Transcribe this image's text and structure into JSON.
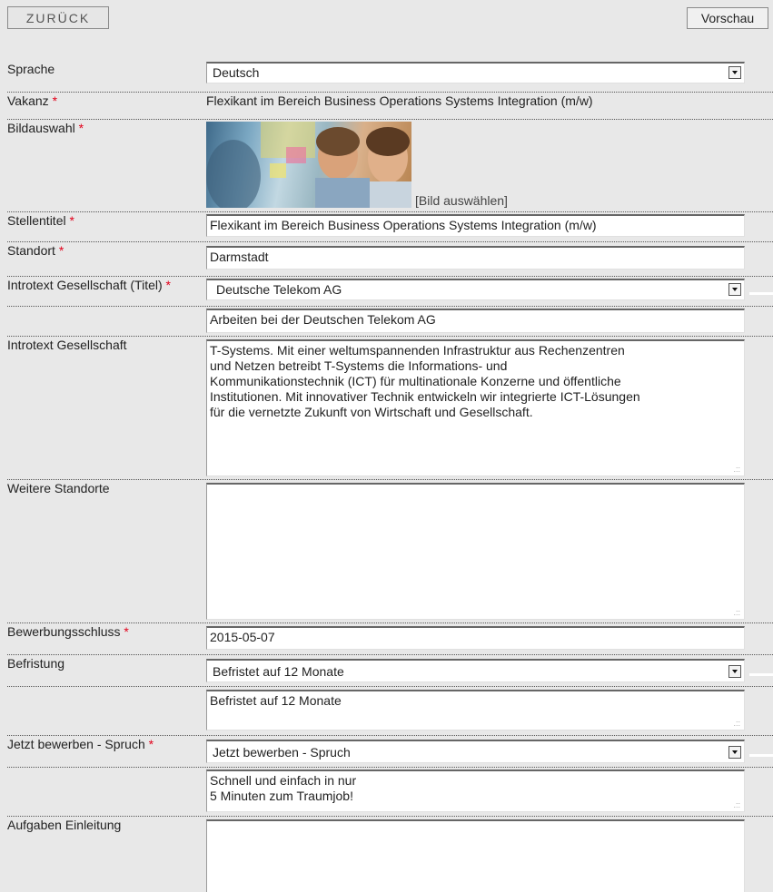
{
  "toolbar": {
    "back_label": "ZURÜCK",
    "preview_label": "Vorschau"
  },
  "form": {
    "sprache": {
      "label": "Sprache",
      "value": "Deutsch"
    },
    "vakanz": {
      "label": "Vakanz",
      "required": "*",
      "value": "Flexikant im Bereich Business Operations Systems Integration (m/w)"
    },
    "bildauswahl": {
      "label": "Bildauswahl",
      "required": "*",
      "link": "[Bild auswählen]"
    },
    "stellentitel": {
      "label": "Stellentitel",
      "required": "*",
      "value": "Flexikant im Bereich Business Operations Systems Integration (m/w)"
    },
    "standort": {
      "label": "Standort",
      "required": "*",
      "value": "Darmstadt"
    },
    "introtext_titel": {
      "label": "Introtext Gesellschaft (Titel)",
      "required": "*",
      "select_value": "Deutsche Telekom AG",
      "text_value": "Arbeiten bei der Deutschen Telekom AG"
    },
    "introtext": {
      "label": "Introtext Gesellschaft",
      "lines": [
        "T-Systems. Mit einer weltumspannenden Infrastruktur aus Rechenzentren",
        "und Netzen betreibt T-Systems die Informations- und",
        "Kommunikationstechnik (ICT) für multinationale Konzerne und öffentliche",
        "Institutionen. Mit innovativer Technik entwickeln wir integrierte ICT-Lösungen",
        "für die vernetzte Zukunft von Wirtschaft und Gesellschaft."
      ]
    },
    "weitere_standorte": {
      "label": "Weitere Standorte",
      "value": ""
    },
    "bewerbungsschluss": {
      "label": "Bewerbungsschluss",
      "required": "*",
      "value": "2015-05-07"
    },
    "befristung": {
      "label": "Befristung",
      "select_value": "Befristet auf 12 Monate",
      "text_value": "Befristet auf 12 Monate"
    },
    "spruch": {
      "label": "Jetzt bewerben - Spruch",
      "required": "*",
      "select_value": "Jetzt bewerben - Spruch",
      "lines": [
        "Schnell und einfach in nur",
        "5 Minuten zum Traumjob!"
      ]
    },
    "aufgaben": {
      "label": "Aufgaben Einleitung",
      "value": ""
    }
  }
}
